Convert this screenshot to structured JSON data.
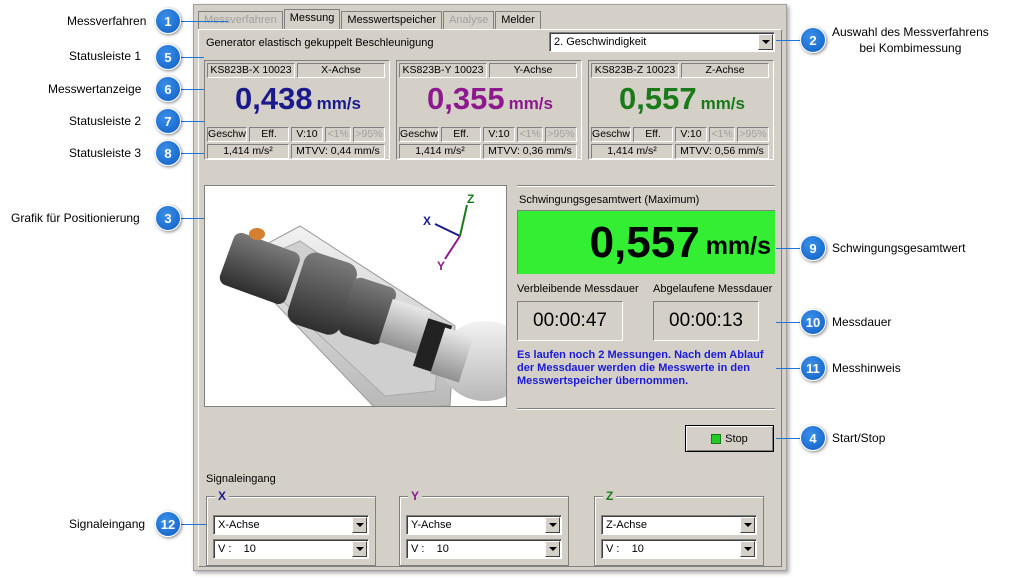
{
  "tabs": [
    {
      "label": "Messverfahren",
      "state": "disabled"
    },
    {
      "label": "Messung",
      "state": "active"
    },
    {
      "label": "Messwertspeicher",
      "state": "normal"
    },
    {
      "label": "Analyse",
      "state": "disabled"
    },
    {
      "label": "Melder",
      "state": "normal"
    }
  ],
  "method_text": "Generator elastisch gekuppelt Beschleunigung",
  "method_combo": "2. Geschwindigkeit",
  "sensors": [
    {
      "id": "KS823B-X 10023",
      "axis": "X-Achse",
      "value": "0,438",
      "unit": "mm/s",
      "color": "#1a1a8c",
      "s2": [
        "Geschw",
        "Eff.",
        "V:10",
        "<1%",
        ">95%"
      ],
      "s3a": "1,414 m/s²",
      "s3b": "MTVV: 0,44 mm/s"
    },
    {
      "id": "KS823B-Y 10023",
      "axis": "Y-Achse",
      "value": "0,355",
      "unit": "mm/s",
      "color": "#8c1a8c",
      "s2": [
        "Geschw",
        "Eff.",
        "V:10",
        "<1%",
        ">95%"
      ],
      "s3a": "1,414 m/s²",
      "s3b": "MTVV: 0,36 mm/s"
    },
    {
      "id": "KS823B-Z 10023",
      "axis": "Z-Achse",
      "value": "0,557",
      "unit": "mm/s",
      "color": "#1a7a1a",
      "s2": [
        "Geschw",
        "Eff.",
        "V:10",
        "<1%",
        ">95%"
      ],
      "s3a": "1,414 m/s²",
      "s3b": "MTVV: 0,56 mm/s"
    }
  ],
  "total": {
    "label": "Schwingungsgesamtwert (Maximum)",
    "value": "0,557",
    "unit": "mm/s",
    "bg": "#33ee33"
  },
  "remaining": {
    "label": "Verbleibende Messdauer",
    "value": "00:00:47"
  },
  "elapsed": {
    "label": "Abgelaufene Messdauer",
    "value": "00:00:13"
  },
  "hint": "Es laufen noch 2 Messungen. Nach dem Ablauf der Messdauer werden die Messwerte in den Messwertspeicher übernommen.",
  "stop_label": "Stop",
  "signal_title": "Signaleingang",
  "signals": [
    {
      "axis": "X",
      "color": "#1a1a8c",
      "input": "X-Achse",
      "gain": "V :    10"
    },
    {
      "axis": "Y",
      "color": "#8c1a8c",
      "input": "Y-Achse",
      "gain": "V :    10"
    },
    {
      "axis": "Z",
      "color": "#1a7a1a",
      "input": "Z-Achse",
      "gain": "V :    10"
    }
  ],
  "axes_labels": {
    "x": "X",
    "y": "Y",
    "z": "Z"
  },
  "callouts_left": [
    {
      "n": "1",
      "label": "Messverfahren"
    },
    {
      "n": "5",
      "label": "Statusleiste 1"
    },
    {
      "n": "6",
      "label": "Messwertanzeige"
    },
    {
      "n": "7",
      "label": "Statusleiste 2"
    },
    {
      "n": "8",
      "label": "Statusleiste 3"
    },
    {
      "n": "3",
      "label": "Grafik für Positionierung"
    },
    {
      "n": "12",
      "label": "Signaleingang"
    }
  ],
  "callouts_right": [
    {
      "n": "2",
      "label": "Auswahl des Messverfahrens\nbei Kombimessung"
    },
    {
      "n": "9",
      "label": "Schwingungsgesamtwert"
    },
    {
      "n": "10",
      "label": "Messdauer"
    },
    {
      "n": "11",
      "label": "Messhinweis"
    },
    {
      "n": "4",
      "label": "Start/Stop"
    }
  ]
}
